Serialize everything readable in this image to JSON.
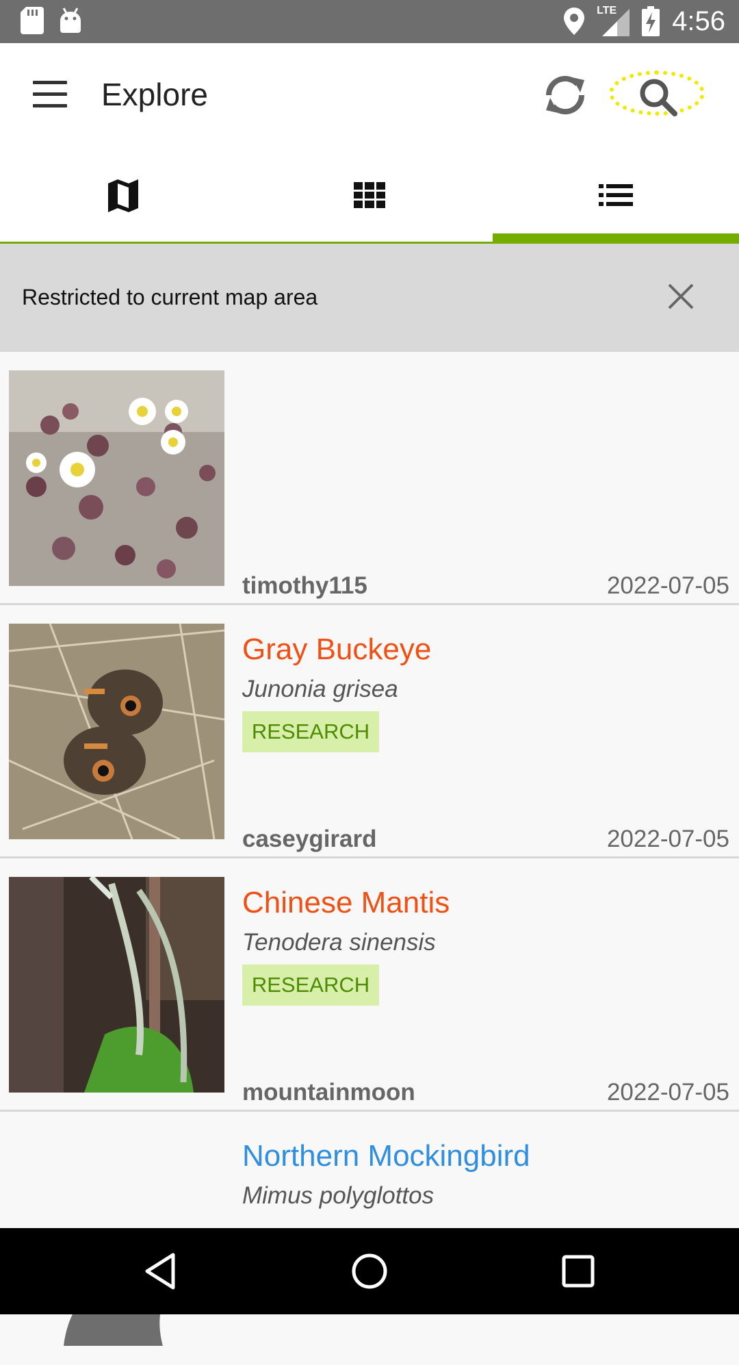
{
  "status_bar": {
    "time": "4:56",
    "network": "LTE",
    "icons": [
      "sd-card-icon",
      "android-icon",
      "location-icon",
      "signal-icon",
      "battery-charging-icon"
    ]
  },
  "app_bar": {
    "title": "Explore",
    "icons": [
      "menu-icon",
      "refresh-icon",
      "search-icon"
    ]
  },
  "tabs": [
    {
      "name": "map",
      "icon": "map-icon",
      "selected": false
    },
    {
      "name": "grid",
      "icon": "grid-icon",
      "selected": false
    },
    {
      "name": "list",
      "icon": "list-icon",
      "selected": true
    }
  ],
  "colors": {
    "accent": "#74ac00",
    "highlight": "#f0ea00",
    "common_name_plant": "#f05014",
    "common_name_bird": "#2f8ee0",
    "badge_bg": "#d8efaa",
    "badge_text": "#4c8c00"
  },
  "banner": {
    "text": "Restricted to current map area"
  },
  "observations": [
    {
      "common_name": "",
      "scientific_name": "",
      "badge": "",
      "user": "timothy115",
      "date": "2022-07-05"
    },
    {
      "common_name": "Gray Buckeye",
      "scientific_name": "Junonia grisea",
      "badge": "RESEARCH",
      "user": "caseygirard",
      "date": "2022-07-05"
    },
    {
      "common_name": "Chinese Mantis",
      "scientific_name": "Tenodera sinensis",
      "badge": "RESEARCH",
      "user": "mountainmoon",
      "date": "2022-07-05"
    },
    {
      "common_name": "Northern Mockingbird",
      "scientific_name": "Mimus polyglottos",
      "badge": "",
      "user": "",
      "date": ""
    }
  ],
  "nav_bar": {
    "buttons": [
      "back-icon",
      "home-icon",
      "recents-icon"
    ]
  }
}
